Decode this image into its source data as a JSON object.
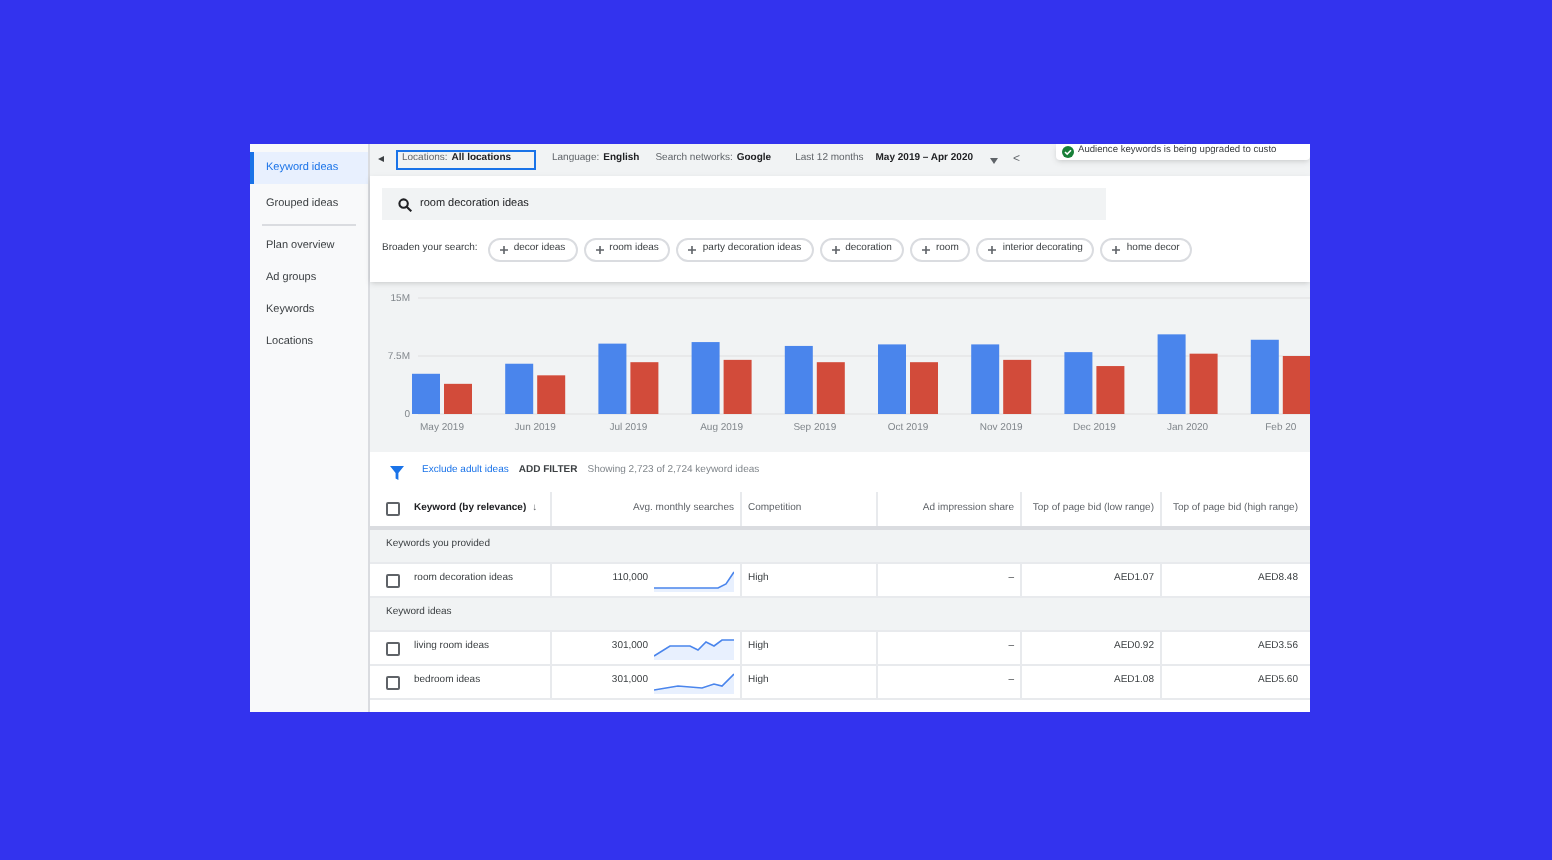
{
  "sidebar": {
    "items": [
      {
        "label": "Keyword ideas",
        "selected": true
      },
      {
        "label": "Grouped ideas",
        "selected": false
      },
      {
        "label": "Plan overview",
        "selected": false
      },
      {
        "label": "Ad groups",
        "selected": false
      },
      {
        "label": "Keywords",
        "selected": false
      },
      {
        "label": "Locations",
        "selected": false
      }
    ]
  },
  "top_bar": {
    "back": "◂",
    "locations_label": "Locations:",
    "locations_value": "All locations",
    "language_label": "Language:",
    "language_value": "English",
    "networks_label": "Search networks:",
    "networks_value": "Google",
    "period_label": "Last 12 months",
    "period_value": "May 2019 – Apr 2020",
    "prev": "<"
  },
  "toast": {
    "text": "Audience keywords is being upgraded to custo"
  },
  "search": {
    "value": "room decoration ideas"
  },
  "broaden": {
    "label": "Broaden your search:",
    "chips": [
      "decor ideas",
      "room ideas",
      "party decoration ideas",
      "decoration",
      "room",
      "interior decorating",
      "home decor"
    ]
  },
  "chart": {
    "chart_data": {
      "type": "bar",
      "categories": [
        "May 2019",
        "Jun 2019",
        "Jul 2019",
        "Aug 2019",
        "Sep 2019",
        "Oct 2019",
        "Nov 2019",
        "Dec 2019",
        "Jan 2020",
        "Feb 20"
      ],
      "yticks": [
        {
          "value": 0,
          "label": "0"
        },
        {
          "value": 7500000,
          "label": "7.5M"
        },
        {
          "value": 15000000,
          "label": "15M"
        }
      ],
      "ylim": [
        0,
        15000000
      ],
      "series": [
        {
          "color": "#4a85ec",
          "values": [
            5200000,
            6500000,
            9100000,
            9300000,
            8800000,
            9000000,
            9000000,
            8000000,
            10300000,
            9600000
          ]
        },
        {
          "color": "#d24b3a",
          "values": [
            3900000,
            5000000,
            6700000,
            7000000,
            6700000,
            6700000,
            7000000,
            6200000,
            7800000,
            7500000
          ]
        }
      ]
    }
  },
  "filter_bar": {
    "filter_link": "Exclude adult ideas",
    "add_filter": "ADD FILTER",
    "summary": "Showing 2,723 of 2,724 keyword ideas"
  },
  "table": {
    "select_all_checked": false,
    "columns": [
      "Keyword (by relevance)",
      "Avg. monthly searches",
      "Competition",
      "Ad impression share",
      "Top of page bid (low range)",
      "Top of page bid (high range)"
    ],
    "sort_icon": "↓",
    "rows": [
      {
        "kind": "group",
        "label": "Keywords you provided"
      },
      {
        "kind": "keyword",
        "checked": false,
        "cells": [
          "room decoration ideas",
          "110,000",
          "High",
          "–",
          "AED1.07",
          "AED8.48"
        ]
      },
      {
        "kind": "group",
        "label": "Keyword ideas"
      },
      {
        "kind": "keyword",
        "checked": false,
        "cells": [
          "living room ideas",
          "301,000",
          "High",
          "–",
          "AED0.92",
          "AED3.56"
        ]
      },
      {
        "kind": "keyword",
        "checked": false,
        "cells": [
          "bedroom ideas",
          "301,000",
          "High",
          "–",
          "AED1.08",
          "AED5.60"
        ]
      }
    ]
  }
}
